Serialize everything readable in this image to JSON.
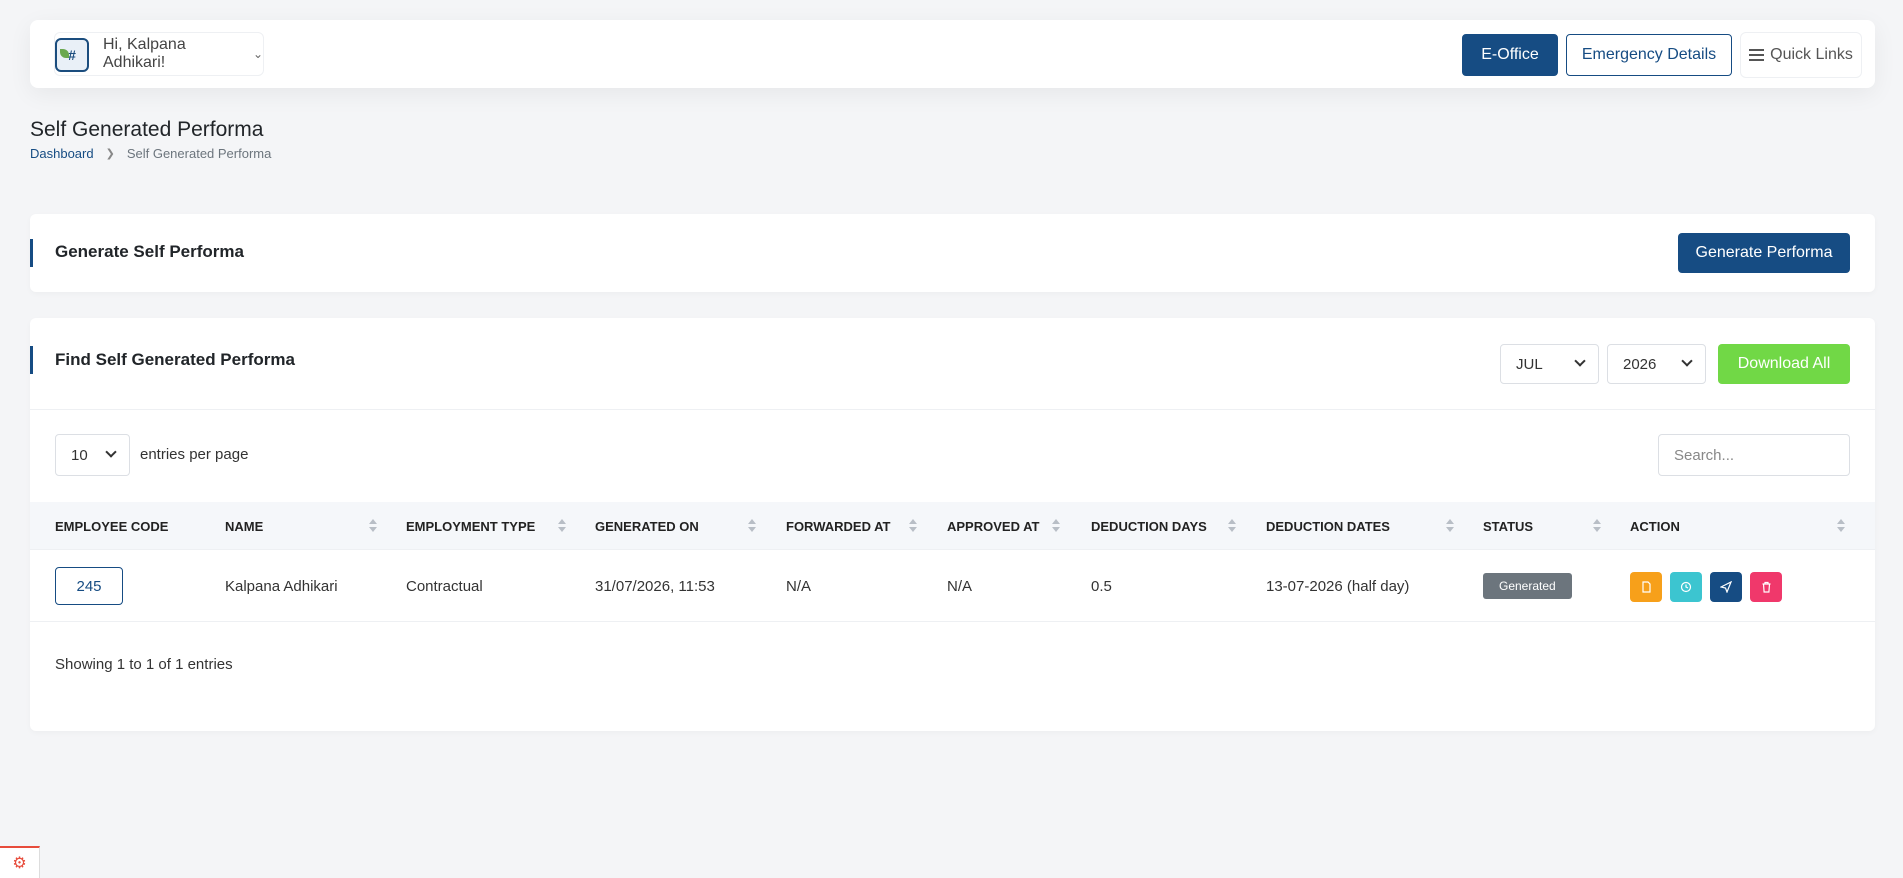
{
  "header": {
    "greeting": "Hi, Kalpana Adhikari!",
    "avatar_glyph": "#",
    "eoffice_label": "E-Office",
    "emergency_label": "Emergency Details",
    "quick_links_label": "Quick Links"
  },
  "page": {
    "title": "Self Generated Performa",
    "breadcrumb": [
      "Dashboard",
      "Self Generated Performa"
    ]
  },
  "generate_card": {
    "title": "Generate Self Performa",
    "button_label": "Generate Performa"
  },
  "find_card": {
    "title": "Find Self Generated Performa",
    "month": "JUL",
    "year": "2026",
    "download_label": "Download All",
    "page_size": "10",
    "entries_label": "entries per page",
    "search_placeholder": "Search...",
    "columns": [
      "EMPLOYEE CODE",
      "NAME",
      "EMPLOYMENT TYPE",
      "GENERATED ON",
      "FORWARDED AT",
      "APPROVED AT",
      "DEDUCTION DAYS",
      "DEDUCTION DATES",
      "STATUS",
      "ACTION"
    ],
    "rows": [
      {
        "employee_code": "245",
        "name": "Kalpana Adhikari",
        "employment_type": "Contractual",
        "generated_on": "31/07/2026, 11:53",
        "forwarded_at": "N/A",
        "approved_at": "N/A",
        "deduction_days": "0.5",
        "deduction_dates": "13-07-2026 (half day)",
        "status": "Generated"
      }
    ],
    "showing_text": "Showing 1 to 1 of 1 entries"
  },
  "colors": {
    "primary": "#164c83",
    "success": "#71d846",
    "warning": "#f7a01a",
    "info": "#3cc5d0",
    "danger": "#f0386b",
    "badge": "#6c757d"
  },
  "icons": {
    "user_menu": "chevron-down-icon",
    "quick_links": "list-icon",
    "actions": [
      "document-icon",
      "history-icon",
      "send-icon",
      "trash-icon"
    ],
    "footer": "laravel-icon"
  }
}
